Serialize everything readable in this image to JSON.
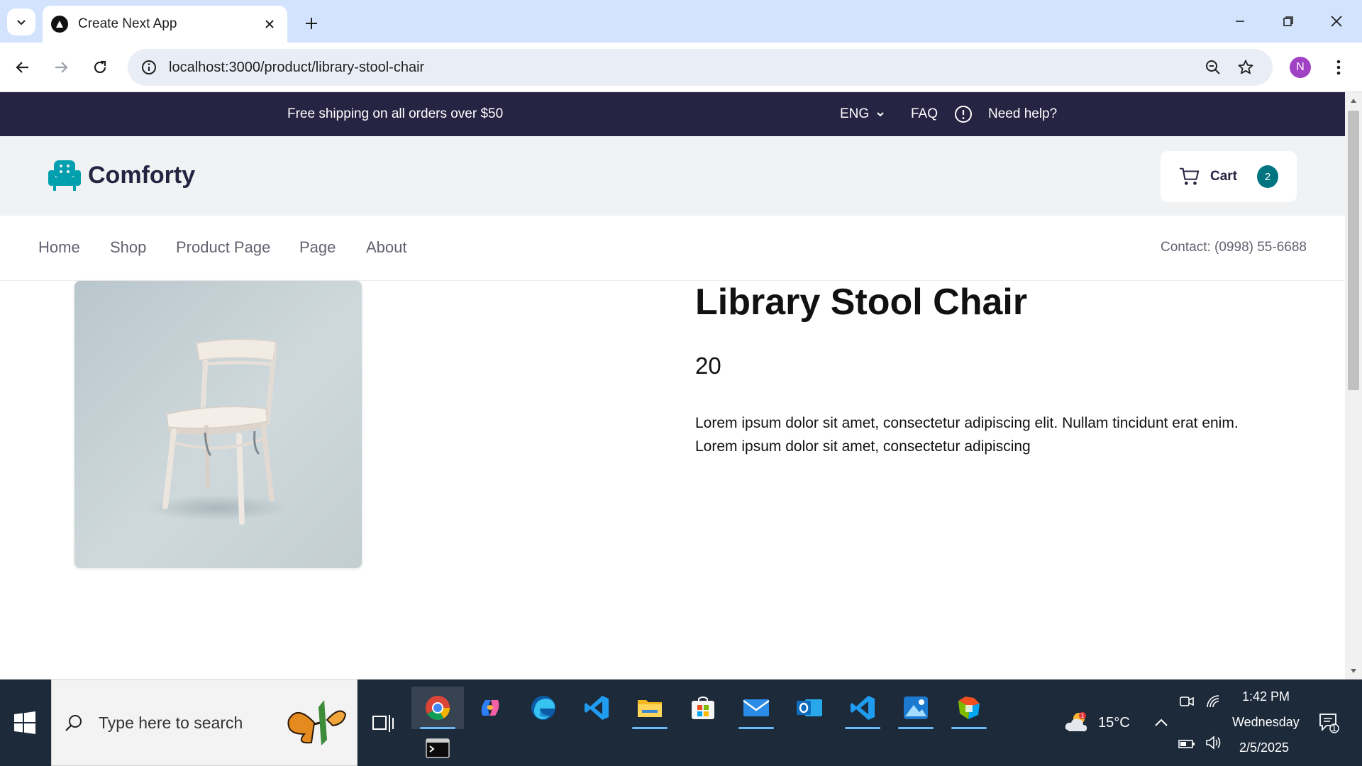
{
  "browser": {
    "tab_title": "Create Next App",
    "url_host": "localhost",
    "url_rest": ":3000/product/library-stool-chair",
    "profile_initial": "N"
  },
  "topbar": {
    "shipping_text": "Free shipping on all orders over $50",
    "language": "ENG",
    "faq": "FAQ",
    "help": "Need help?"
  },
  "header": {
    "brand": "Comforty",
    "cart_label": "Cart",
    "cart_count": "2"
  },
  "nav": {
    "items": [
      "Home",
      "Shop",
      "Product Page",
      "Page",
      "About"
    ],
    "contact": "Contact: (0998) 55-6688"
  },
  "product": {
    "title": "Library Stool Chair",
    "price": "20",
    "description": "Lorem ipsum dolor sit amet, consectetur adipiscing elit. Nullam tincidunt erat enim. Lorem ipsum dolor sit amet, consectetur adipiscing"
  },
  "taskbar": {
    "search_placeholder": "Type here to search",
    "weather": "15°C",
    "time": "1:42 PM",
    "day": "Wednesday",
    "date": "2/5/2025",
    "notification_count": "1"
  },
  "colors": {
    "topbar_bg": "#272343",
    "accent_teal": "#007580",
    "header_bg": "#f0f2f3",
    "logo_icon": "#029fae"
  }
}
